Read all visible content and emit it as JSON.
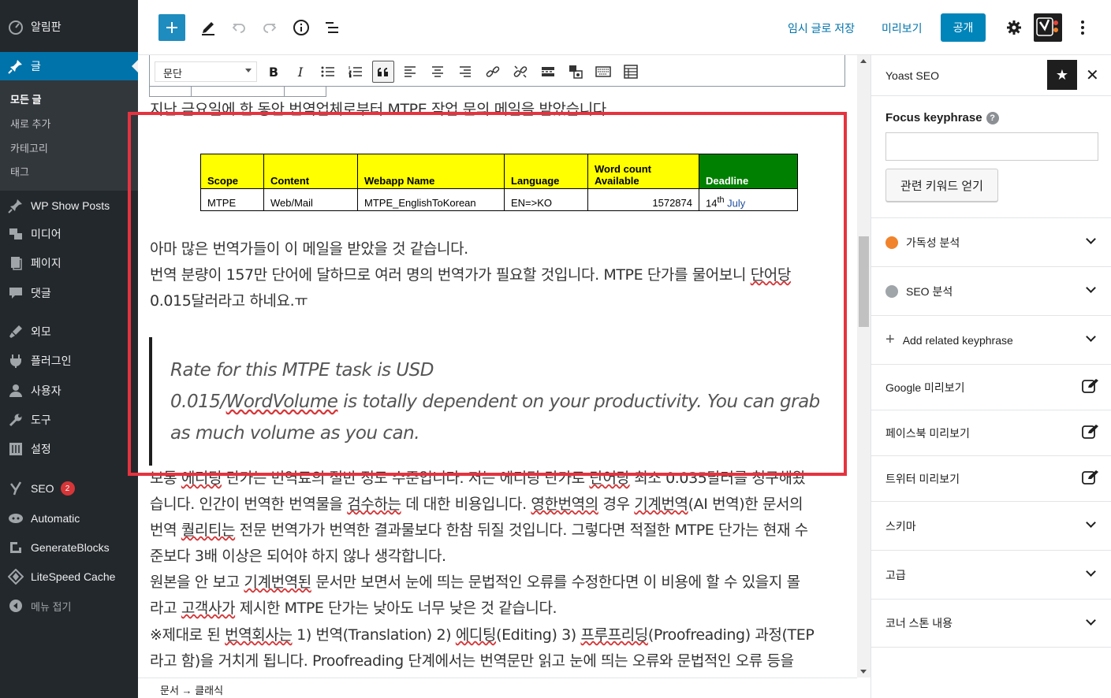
{
  "admin_menu": {
    "dashboard": "알림판",
    "posts": "글",
    "posts_sub": [
      "모든 글",
      "새로 추가",
      "카테고리",
      "태그"
    ],
    "wp_show_posts": "WP Show Posts",
    "media": "미디어",
    "pages": "페이지",
    "comments": "댓글",
    "appearance": "외모",
    "plugins": "플러그인",
    "users": "사용자",
    "tools": "도구",
    "settings": "설정",
    "seo": "SEO",
    "seo_badge": "2",
    "automatic": "Automatic",
    "generateblocks": "GenerateBlocks",
    "litespeed": "LiteSpeed Cache",
    "collapse": "메뉴 접기"
  },
  "toolbar": {
    "save_draft": "임시 글로 저장",
    "preview": "미리보기",
    "publish": "공개"
  },
  "classic_toolbar": {
    "format": "문단"
  },
  "content": {
    "intro": "지난 금요일에 한 동안 번역업체로부터 MTPE 작업 문의 메일을 받았습니다.",
    "table_headers": [
      "Scope",
      "Content",
      "Webapp Name",
      "Language",
      "Word count Available",
      "Deadline"
    ],
    "table_row": [
      "MTPE",
      "Web/Mail",
      "MTPE_EnglishToKorean",
      "EN=>KO",
      "1572874",
      "14",
      "th",
      " July"
    ],
    "p1": "아마 많은 번역가들이 이 메일을 받았을 것 같습니다.",
    "p2a": "번역 분량이 157만 단어에 달하므로 여러 명의 번역가가 필요할 것입니다. MTPE 단가를 물어보니 ",
    "p2b": "단어당",
    "p2c": "0.015달러라고 하네요.ㅠ",
    "quote_l1": "Rate for this MTPE task is USD",
    "quote_l2a": "0.015/",
    "quote_l2b": "WordVolume",
    "quote_l2c": " is totally dependent on your productivity. You can grab",
    "quote_l3": "as much volume as you can.",
    "p3a": "보통 ",
    "p3b": "에디팅",
    "p3c": " 단가는 번역료의 절반 정도 수준입니다. 저는 에디팅 단가로 ",
    "p3d": "단어당",
    "p3e": " 최소 0.035달러를 청구해왔",
    "p4a": "습니다. 인간이 번역한 번역물을 ",
    "p4b": "검수하는",
    "p4c": " 데 대한 비용입니다. ",
    "p4d": "영한번역의",
    "p4e": " 경우 ",
    "p4f": "기계번역",
    "p4g": "(AI 번역)한 문서의",
    "p5a": "번역 ",
    "p5b": "퀄리티는",
    "p5c": " 전문 번역가가 번역한 결과물보다 한참 뒤질 것입니다. 그렇다면 적절한 MTPE 단가는 현재 수",
    "p6": "준보다 3배 이상은 되어야 하지 않나 생각합니다.",
    "p7a": "원본을 안 보고 ",
    "p7b": "기계번역된",
    "p7c": " 문서만 보면서 눈에 띄는 문법적인 오류를 수정한다면 이 비용에 할 수 있을지 몰",
    "p8a": "라고 ",
    "p8b": "고객사가",
    "p8c": " 제시한 MTPE 단가는 낮아도 너무 낮은 것 같습니다.",
    "p9a": "※제대로 된 ",
    "p9b": "번역회사는",
    "p9c": " 1) 번역(Translation) 2) ",
    "p9d": "에디팅",
    "p9e": "(Editing) 3) ",
    "p9f": "프루프리딩",
    "p9g": "(Proofreading) 과정(TEP",
    "p10": "라고 함)을 거치게 됩니다. Proofreading 단계에서는 번역문만 읽고 눈에 띄는 오류와 문법적인 오류 등을"
  },
  "footer": {
    "breadcrumb": "문서 → 클래식"
  },
  "sidebar": {
    "title": "Yoast SEO",
    "focus_label": "Focus keyphrase",
    "related_btn": "관련 키워드 얻기",
    "panels": [
      "가독성 분석",
      "SEO 분석",
      "Add related keyphrase",
      "Google 미리보기",
      "페이스북 미리보기",
      "트위터 미리보기",
      "스키마",
      "고급",
      "코너 스톤 내용"
    ]
  },
  "colors": {
    "admin_bg": "#23282d",
    "accent": "#0073aa",
    "highlight_box": "#e5333f",
    "readability_dot": "#f0832b",
    "seo_dot": "#a0a5aa"
  }
}
